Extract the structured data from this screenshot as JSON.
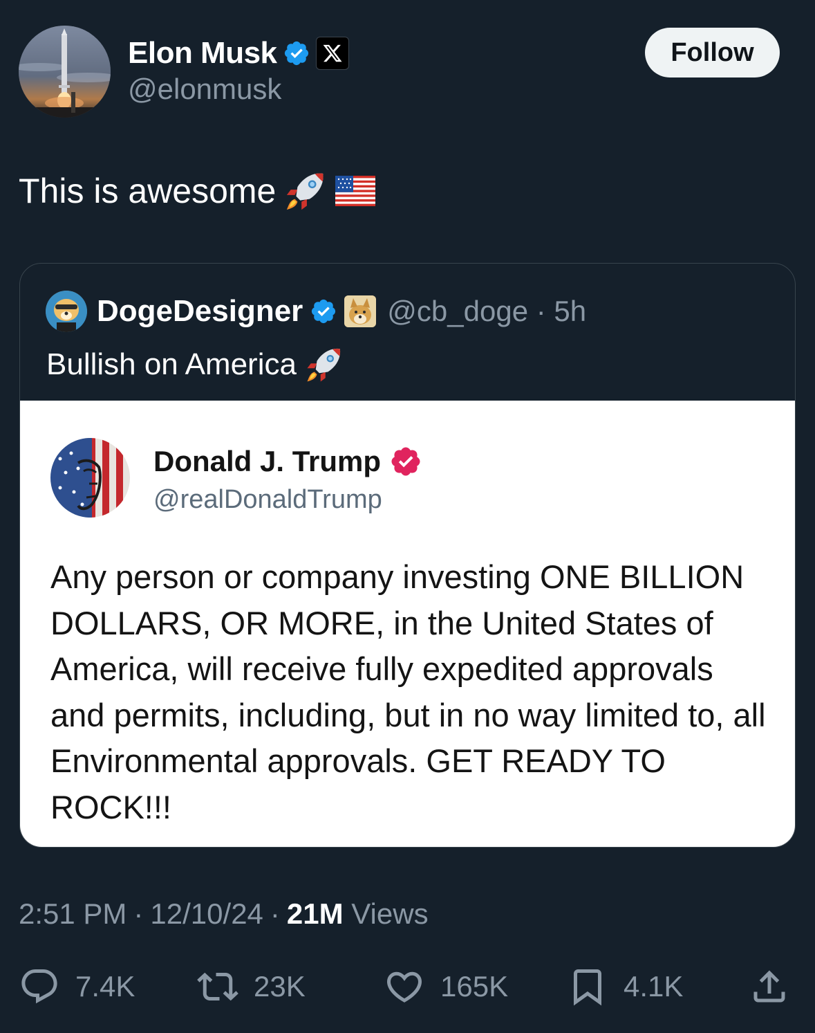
{
  "author": {
    "display_name": "Elon Musk",
    "handle": "@elonmusk",
    "verified_color": "#1d9bf0"
  },
  "follow_label": "Follow",
  "post": {
    "text": "This is awesome",
    "emojis": [
      "rocket-icon",
      "us-flag-icon"
    ]
  },
  "quote": {
    "display_name": "DogeDesigner",
    "handle_time": "@cb_doge · 5h",
    "text": "Bullish on America",
    "embedded": {
      "display_name": "Donald J. Trump",
      "handle": "@realDonaldTrump",
      "badge_color": "#e0245e",
      "body": "Any person or company investing ONE BILLION DOLLARS, OR MORE, in the United States of America, will receive fully expedited approvals and permits, including, but in no way limited to, all Environmental approvals. GET READY TO ROCK!!!"
    }
  },
  "meta": {
    "time": "2:51 PM",
    "date": "12/10/24",
    "views_count": "21M",
    "views_label": "Views"
  },
  "actions": {
    "replies": "7.4K",
    "reposts": "23K",
    "likes": "165K",
    "bookmarks": "4.1K"
  }
}
